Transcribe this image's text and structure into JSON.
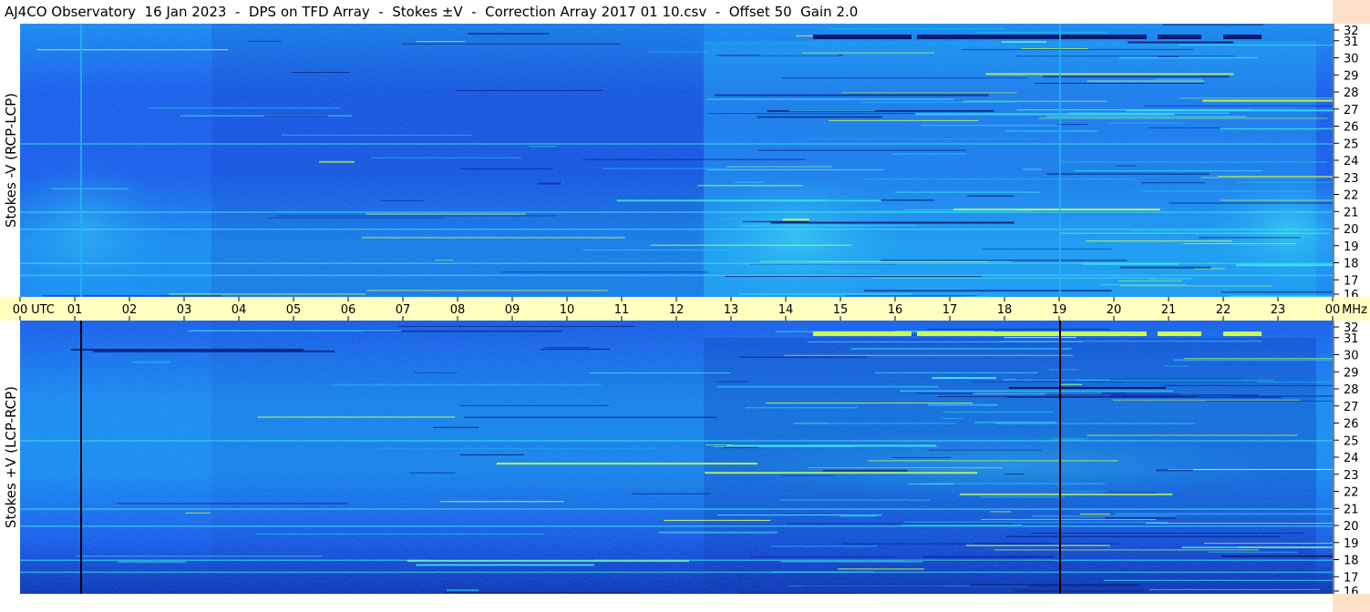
{
  "title": "AJ4CO Observatory  16 Jan 2023  -  DPS on TFD Array  -  Stokes ±V  -  Correction Array 2017 01 10.csv  -  Offset 50  Gain 2.0",
  "chart_data": [
    {
      "type": "heatmap",
      "panel": "top",
      "ylabel": "Stokes -V (RCP-LCP)",
      "xlabel": "UTC",
      "ylabel_right": "MHz",
      "x_range_utc_hours": [
        0,
        24
      ],
      "y_range_mhz": [
        16,
        32
      ],
      "y_ticks": [
        "16",
        "17",
        "18",
        "19",
        "20",
        "21",
        "22",
        "23",
        "24",
        "25",
        "26",
        "27",
        "28",
        "29",
        "30",
        "31",
        "32"
      ],
      "colormap": [
        "#0a1a6e",
        "#0c2fb0",
        "#1a5ae8",
        "#1a8af0",
        "#22b8f0",
        "#40e8f0",
        "#c8ff50"
      ],
      "features": [
        {
          "name": "enhanced band",
          "start_utc": 12.5,
          "end_utc": 23.7,
          "freq_mhz": [
            16,
            31
          ]
        },
        {
          "name": "strong feature near 31 MHz",
          "start_utc": 14.5,
          "end_utc": 22.7,
          "freq_mhz": 31.2
        }
      ]
    },
    {
      "type": "heatmap",
      "panel": "bottom",
      "ylabel": "Stokes +V (LCP-RCP)",
      "xlabel": "UTC",
      "ylabel_right": "MHz",
      "x_range_utc_hours": [
        0,
        24
      ],
      "y_range_mhz": [
        16,
        32
      ],
      "y_ticks": [
        "16",
        "17",
        "18",
        "19",
        "20",
        "21",
        "22",
        "23",
        "24",
        "25",
        "26",
        "27",
        "28",
        "29",
        "30",
        "31",
        "32"
      ],
      "colormap": [
        "#0a1a6e",
        "#0c2fb0",
        "#1a5ae8",
        "#1a8af0",
        "#22b8f0",
        "#40e8f0",
        "#c8ff50"
      ],
      "features": [
        {
          "name": "enhanced band",
          "start_utc": 12.5,
          "end_utc": 23.7,
          "freq_mhz": [
            16,
            31
          ]
        },
        {
          "name": "strong feature near 31 MHz",
          "start_utc": 14.5,
          "end_utc": 22.7,
          "freq_mhz": 31.2
        }
      ]
    }
  ],
  "time_axis": {
    "ticks": [
      "00",
      "01",
      "02",
      "03",
      "04",
      "05",
      "06",
      "07",
      "08",
      "09",
      "10",
      "11",
      "12",
      "13",
      "14",
      "15",
      "16",
      "17",
      "18",
      "19",
      "20",
      "21",
      "22",
      "23",
      "00"
    ],
    "utc_label": "UTC",
    "unit_label": "MHz"
  }
}
